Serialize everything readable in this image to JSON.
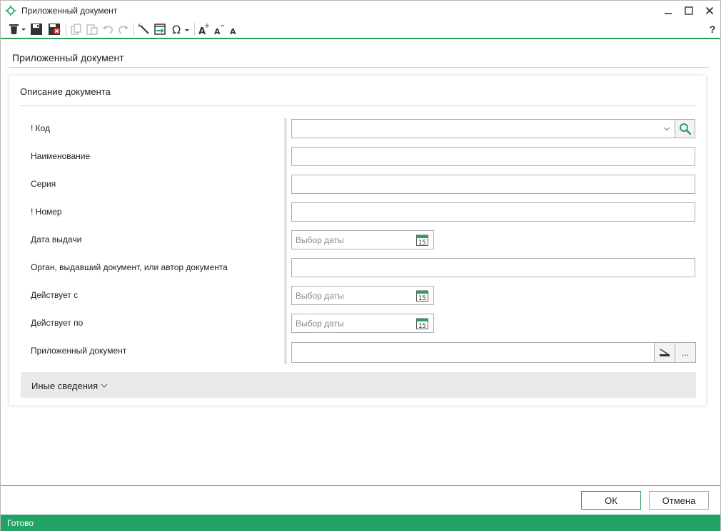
{
  "window": {
    "title": "Приложенный документ",
    "accent_color": "#21a366"
  },
  "toolbar": {
    "items": [
      "trash-icon",
      "save-icon",
      "save-close-icon",
      "copy-icon",
      "paste-icon",
      "undo-icon",
      "redo-icon",
      "wand-icon",
      "export-icon",
      "omega-icon",
      "font-increase-icon",
      "font-decrease-icon",
      "font-reset-icon"
    ],
    "help_label": "?"
  },
  "page": {
    "title": "Приложенный документ"
  },
  "card": {
    "title": "Описание документа",
    "fields": {
      "code": {
        "label": "! Код",
        "value": ""
      },
      "name": {
        "label": "Наименование",
        "value": ""
      },
      "series": {
        "label": "Серия",
        "value": ""
      },
      "number": {
        "label": "! Номер",
        "value": ""
      },
      "issue_date": {
        "label": "Дата выдачи",
        "placeholder": "Выбор даты"
      },
      "authority": {
        "label": "Орган, выдавший документ, или автор документа",
        "value": ""
      },
      "valid_from": {
        "label": "Действует с",
        "placeholder": "Выбор даты"
      },
      "valid_to": {
        "label": "Действует по",
        "placeholder": "Выбор даты"
      },
      "attachment": {
        "label": "Приложенный документ",
        "value": "",
        "browse_label": "..."
      }
    },
    "calendar_day": "15",
    "other_section": {
      "label": "Иные сведения"
    }
  },
  "footer": {
    "ok_label": "ОК",
    "cancel_label": "Отмена"
  },
  "status": {
    "text": "Готово"
  }
}
